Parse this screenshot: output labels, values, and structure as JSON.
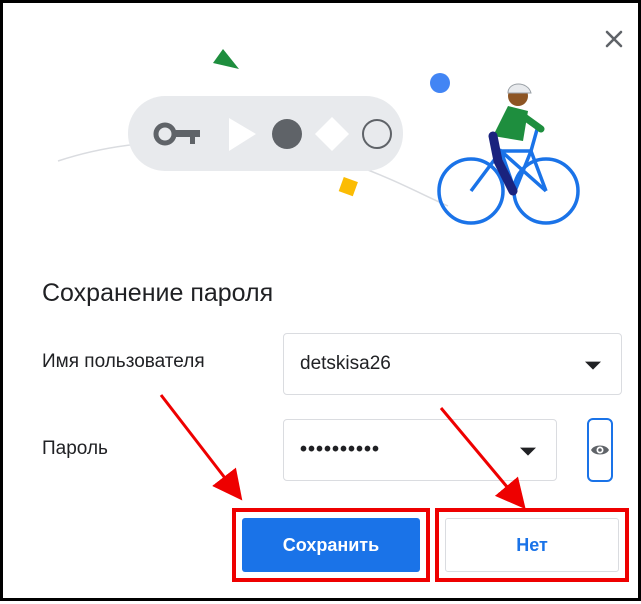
{
  "dialog": {
    "title": "Сохранение пароля",
    "username_label": "Имя пользователя",
    "username_value": "detskisa26",
    "password_label": "Пароль",
    "password_value": "••••••••••",
    "save_label": "Сохранить",
    "no_label": "Нет"
  },
  "icons": {
    "close": "close-icon",
    "key": "key-icon",
    "eye": "eye-icon",
    "dropdown": "chevron-down-icon"
  },
  "colors": {
    "accent": "#1a73e8",
    "highlight": "#ee0000",
    "cyclist_shirt": "#1e8e3e"
  }
}
